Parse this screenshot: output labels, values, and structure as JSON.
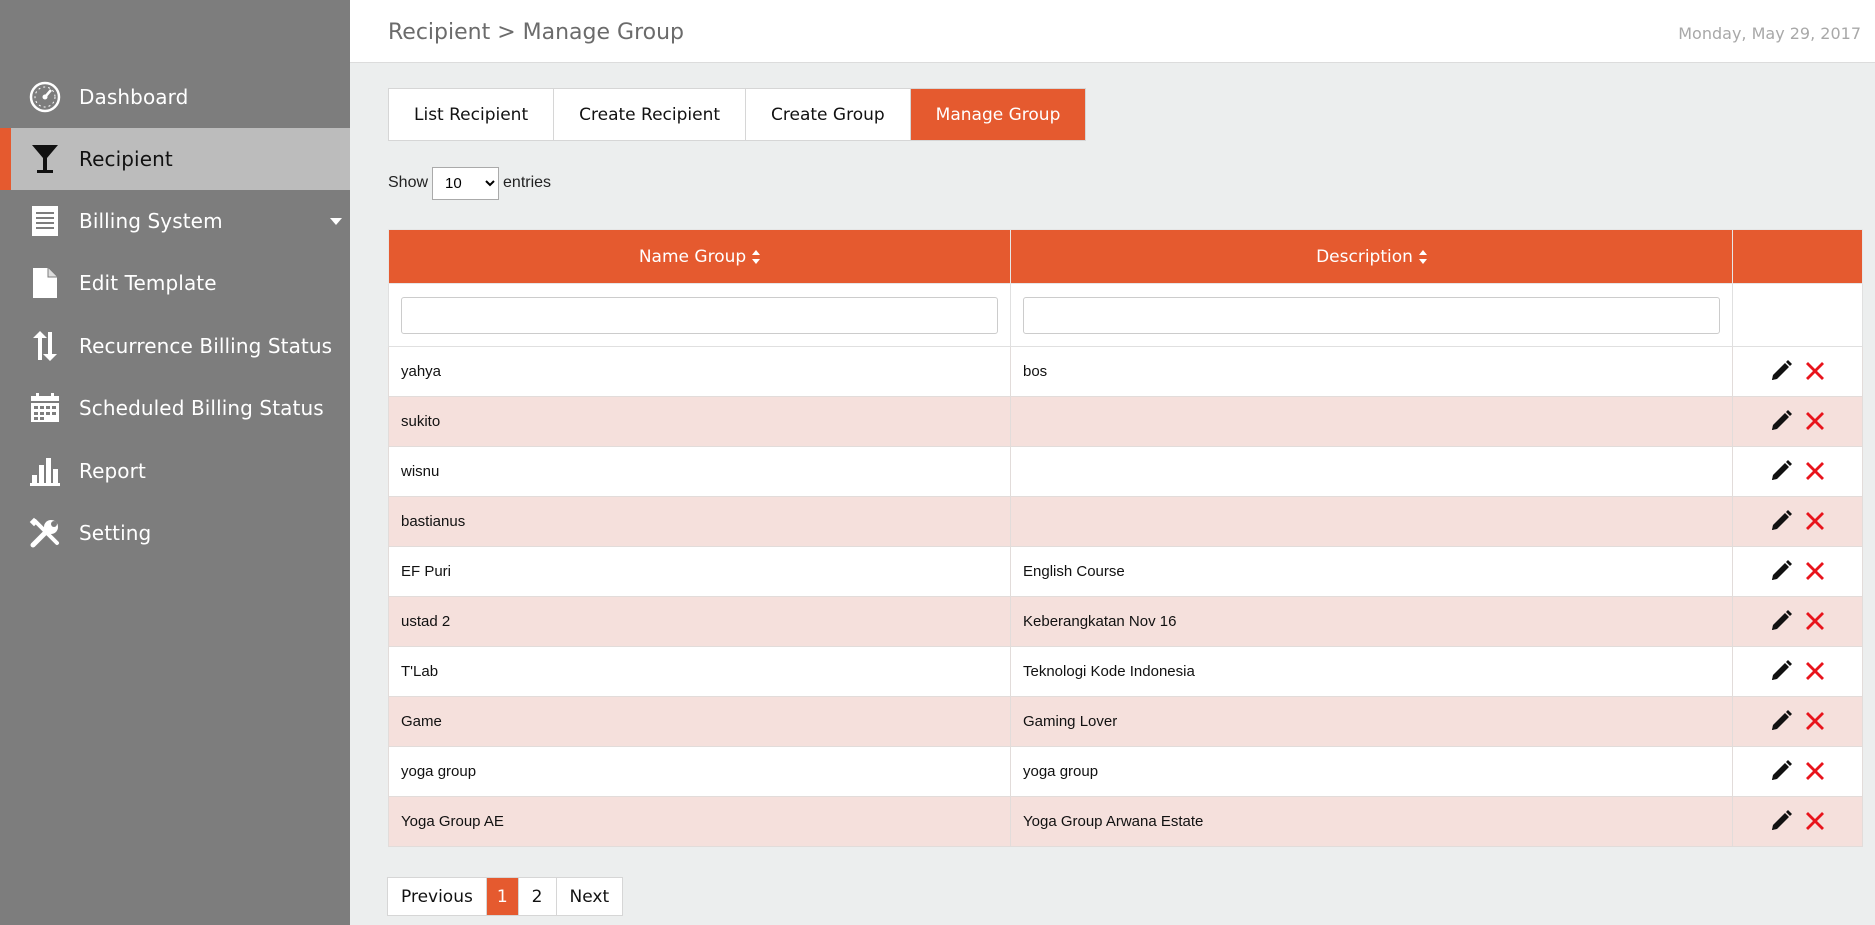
{
  "sidebar": {
    "items": [
      {
        "label": "Dashboard",
        "icon": "dashboard-gauge-icon"
      },
      {
        "label": "Recipient",
        "icon": "cocktail-glass-icon",
        "active": true
      },
      {
        "label": "Billing System",
        "icon": "billing-document-icon",
        "has_submenu": true
      },
      {
        "label": "Edit Template",
        "icon": "file-icon"
      },
      {
        "label": "Recurrence Billing Status",
        "icon": "up-down-arrows-icon"
      },
      {
        "label": "Scheduled Billing Status",
        "icon": "calendar-icon"
      },
      {
        "label": "Report",
        "icon": "bar-chart-icon"
      },
      {
        "label": "Setting",
        "icon": "wrench-screwdriver-icon"
      }
    ]
  },
  "header": {
    "breadcrumb": "Recipient > Manage Group",
    "date": "Monday, May 29, 2017"
  },
  "tabs": [
    {
      "label": "List Recipient"
    },
    {
      "label": "Create Recipient"
    },
    {
      "label": "Create Group"
    },
    {
      "label": "Manage Group",
      "active": true
    }
  ],
  "length_menu": {
    "prefix": "Show",
    "value": "10",
    "suffix": "entries"
  },
  "table": {
    "columns": [
      "Name Group",
      "Description",
      ""
    ],
    "rows": [
      {
        "name": "yahya",
        "description": "bos"
      },
      {
        "name": "sukito",
        "description": ""
      },
      {
        "name": "wisnu",
        "description": ""
      },
      {
        "name": "bastianus",
        "description": ""
      },
      {
        "name": "EF Puri",
        "description": "English Course"
      },
      {
        "name": "ustad 2",
        "description": "Keberangkatan Nov 16"
      },
      {
        "name": "T'Lab",
        "description": "Teknologi Kode Indonesia"
      },
      {
        "name": "Game",
        "description": "Gaming Lover"
      },
      {
        "name": "yoga group",
        "description": "yoga group"
      },
      {
        "name": "Yoga Group AE",
        "description": "Yoga Group Arwana Estate"
      }
    ]
  },
  "pagination": {
    "previous": "Previous",
    "pages": [
      "1",
      "2"
    ],
    "current": "1",
    "next": "Next"
  },
  "colors": {
    "accent": "#e55a2f",
    "sidebar_bg": "#7d7d7d",
    "sidebar_active_bg": "#bcbcbc",
    "row_alt": "#f5e0dc",
    "delete_red": "#e8141c"
  }
}
